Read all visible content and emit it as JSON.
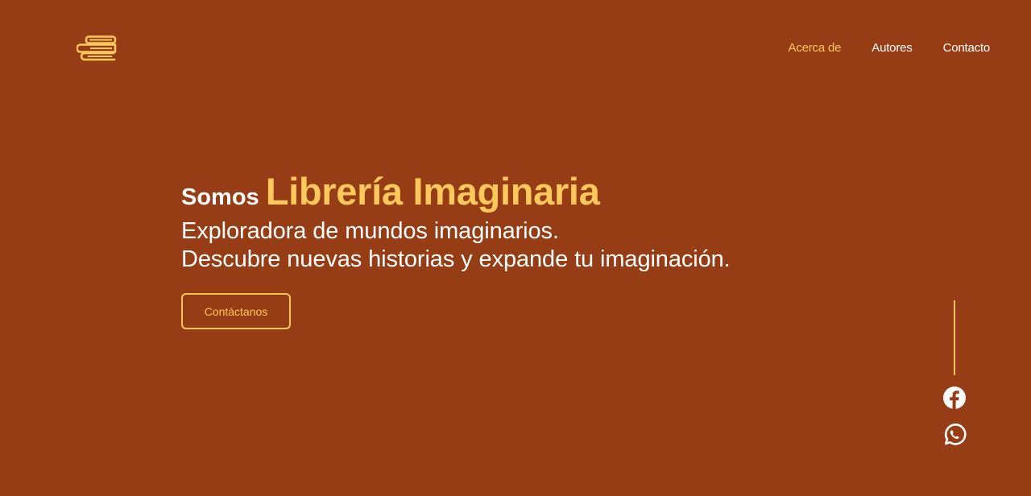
{
  "header": {
    "logo_icon": "books-stack-icon",
    "nav": [
      {
        "label": "Acerca de",
        "active": true
      },
      {
        "label": "Autores",
        "active": false
      },
      {
        "label": "Contacto",
        "active": false
      }
    ]
  },
  "hero": {
    "prefix": "Somos",
    "brand": "Librería Imaginaria",
    "line1": "Exploradora de mundos imaginarios.",
    "line2": "Descubre nuevas historias y expande tu imaginación.",
    "cta_label": "Contáctanos"
  },
  "social": [
    {
      "icon": "facebook-icon"
    },
    {
      "icon": "whatsapp-icon"
    }
  ],
  "colors": {
    "background": "#973d15",
    "accent": "#ffc85c",
    "text": "#ffffff"
  }
}
